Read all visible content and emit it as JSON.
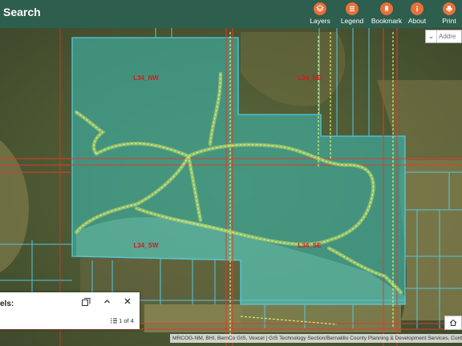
{
  "header": {
    "title": "Search",
    "tools": [
      {
        "label": "Layers",
        "icon": "layers-icon"
      },
      {
        "label": "Legend",
        "icon": "legend-icon"
      },
      {
        "label": "Bookmark",
        "icon": "bookmark-icon"
      },
      {
        "label": "About",
        "icon": "about-icon"
      },
      {
        "label": "Print",
        "icon": "print-icon"
      }
    ]
  },
  "search": {
    "placeholder": "Addre"
  },
  "map": {
    "lot_labels": [
      "L34_NW",
      "L34_NE",
      "L34_SW",
      "L34_SE"
    ],
    "parcel_fill_color": "#3fa89a",
    "parcel_outline_color": "#53c8e0",
    "boundary_line_color": "#e23a2a",
    "trail_color": "#c9e070"
  },
  "panel": {
    "title": "els:",
    "pager": "1 of 4",
    "list_icon": "list-icon",
    "dock_icon": "dock-icon",
    "collapse_icon": "chevron-up-icon",
    "close_icon": "close-icon"
  },
  "attribution": "MRCOG-NM, BHI, BernCo GIS, Vexcel | GIS Technology Section/Bernalillo County Planning & Development Services, Cont",
  "corner_button": {
    "icon": "home-icon"
  }
}
